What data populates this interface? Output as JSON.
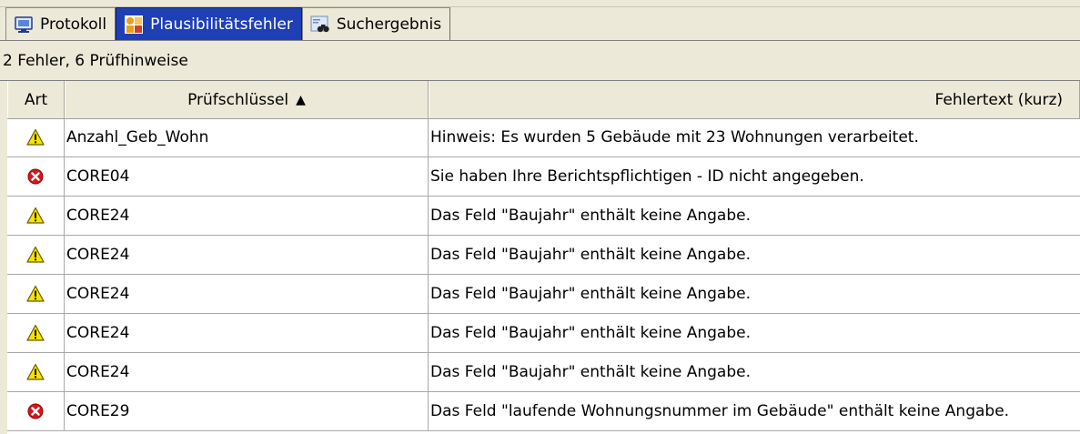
{
  "tabs": [
    {
      "label": "Protokoll",
      "icon": "monitor-icon",
      "active": false
    },
    {
      "label": "Plausibilitätsfehler",
      "icon": "error-list-icon",
      "active": true
    },
    {
      "label": "Suchergebnis",
      "icon": "binoculars-icon",
      "active": false
    }
  ],
  "status": {
    "summary": "2 Fehler, 6 Prüfhinweise"
  },
  "table": {
    "columns": {
      "art": "Art",
      "key": "Prüfschlüssel",
      "text": "Fehlertext (kurz)"
    },
    "sort": {
      "column": "Prüfschlüssel",
      "direction": "ascending",
      "icon": "sort-up-icon"
    },
    "rows": [
      {
        "type": "warning",
        "icon": "warning-icon",
        "key": "Anzahl_Geb_Wohn",
        "text": "Hinweis: Es wurden 5 Gebäude mit 23 Wohnungen verarbeitet."
      },
      {
        "type": "error",
        "icon": "error-icon",
        "key": "CORE04",
        "text": "Sie haben Ihre Berichtspflichtigen - ID nicht angegeben."
      },
      {
        "type": "warning",
        "icon": "warning-icon",
        "key": "CORE24",
        "text": "Das Feld \"Baujahr\" enthält keine Angabe."
      },
      {
        "type": "warning",
        "icon": "warning-icon",
        "key": "CORE24",
        "text": "Das Feld \"Baujahr\" enthält keine Angabe."
      },
      {
        "type": "warning",
        "icon": "warning-icon",
        "key": "CORE24",
        "text": "Das Feld \"Baujahr\" enthält keine Angabe."
      },
      {
        "type": "warning",
        "icon": "warning-icon",
        "key": "CORE24",
        "text": "Das Feld \"Baujahr\" enthält keine Angabe."
      },
      {
        "type": "warning",
        "icon": "warning-icon",
        "key": "CORE24",
        "text": "Das Feld \"Baujahr\" enthält keine Angabe."
      },
      {
        "type": "error",
        "icon": "error-icon",
        "key": "CORE29",
        "text": "Das Feld \"laufende Wohnungsnummer im Gebäude\" enthält keine Angabe."
      }
    ]
  },
  "colors": {
    "active_tab": "#1f3fb5",
    "chrome": "#ece9d8",
    "warning": "#f5e400",
    "error": "#d9141b"
  }
}
